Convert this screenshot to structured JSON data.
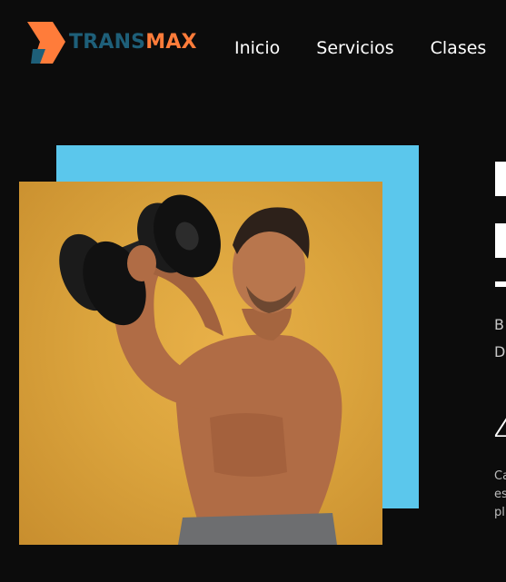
{
  "header": {
    "logo": {
      "part1": "TRANS",
      "part2": "MAX",
      "colors": {
        "mark_top": "#ff7c3a",
        "mark_bottom": "#1e5f79"
      }
    },
    "nav": [
      {
        "label": "Inicio"
      },
      {
        "label": "Servicios"
      },
      {
        "label": "Clases"
      }
    ]
  },
  "hero": {
    "image": "man-lifting-dumbbell",
    "accent_color": "#5bc7ec",
    "subtitle_lines": [
      "B",
      "D"
    ],
    "stat_value": "4",
    "stat_desc_lines": [
      "Ca",
      "es",
      "pl"
    ]
  }
}
